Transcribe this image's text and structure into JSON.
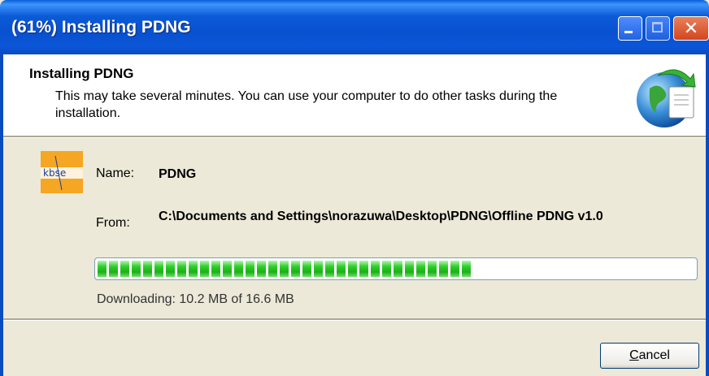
{
  "window": {
    "title": "(61%) Installing PDNG"
  },
  "header": {
    "title": "Installing PDNG",
    "description": "This may take several minutes. You can use your computer to do other tasks during the installation."
  },
  "app": {
    "icon_text": "kbse",
    "name_label": "Name:",
    "name_value": "PDNG",
    "from_label": "From:",
    "from_value": "C:\\Documents and Settings\\norazuwa\\Desktop\\PDNG\\Offline PDNG v1.0"
  },
  "progress": {
    "fraction": 0.61,
    "segments_filled": 33
  },
  "status": {
    "text": "Downloading: 10.2 MB of 16.6 MB"
  },
  "buttons": {
    "cancel_first": "C",
    "cancel_rest": "ancel"
  },
  "icons": [
    "minimize-icon",
    "maximize-icon",
    "close-icon",
    "globe-icon",
    "kbse-logo-icon"
  ],
  "colors": {
    "titlebar": "#0a5fd8",
    "progress": "#2fd12a",
    "close": "#d2461e"
  }
}
